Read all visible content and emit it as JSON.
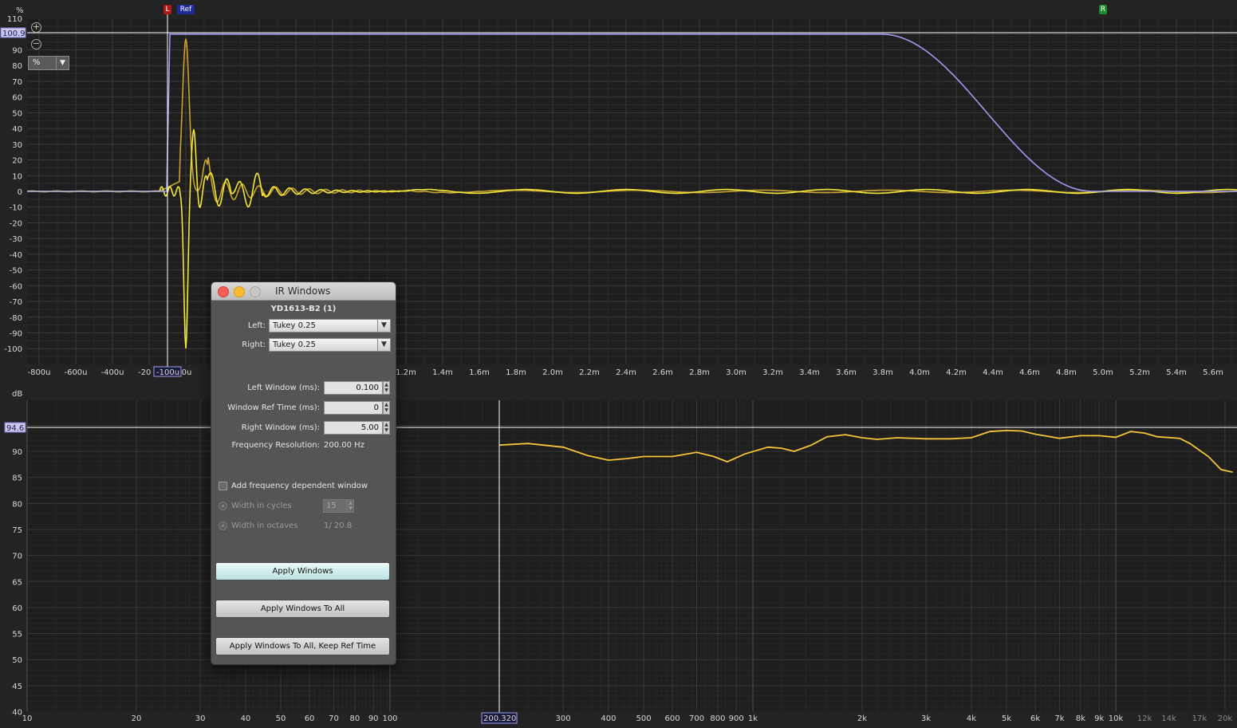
{
  "ir_plot": {
    "y_unit": "%",
    "unit_select": "%",
    "cursor_y": "100.9",
    "y_ticks": [
      "110",
      "100",
      "90",
      "80",
      "70",
      "60",
      "50",
      "40",
      "30",
      "20",
      "10",
      "0",
      "-10",
      "-20",
      "-30",
      "-40",
      "-50",
      "-60",
      "-70",
      "-80",
      "-90",
      "-100"
    ],
    "x_ticks": [
      "-800u",
      "-600u",
      "-400u",
      "-20",
      "0u",
      "1.2m",
      "1.4m",
      "1.6m",
      "1.8m",
      "2.0m",
      "2.2m",
      "2.4m",
      "2.6m",
      "2.8m",
      "3.0m",
      "3.2m",
      "3.4m",
      "3.6m",
      "3.8m",
      "4.0m",
      "4.2m",
      "4.4m",
      "4.6m",
      "4.8m",
      "5.0m",
      "5.2m",
      "5.4m",
      "5.6m"
    ],
    "cursor_x": "-100u",
    "markers": {
      "left": "L",
      "ref": "Ref",
      "right": "R"
    },
    "colors": {
      "window": "#9c9cf0",
      "ir_bright": "#f3e838",
      "ir_dark": "#c9a230",
      "background": "#1e1e1e"
    }
  },
  "fr_plot": {
    "y_unit": "dB",
    "cursor_y": "94.6",
    "y_ticks": [
      "90",
      "85",
      "80",
      "75",
      "70",
      "65",
      "60",
      "55",
      "50",
      "45",
      "40"
    ],
    "x_ticks": [
      "10",
      "20",
      "30",
      "40",
      "50",
      "60",
      "70",
      "80",
      "90",
      "100",
      "300",
      "400",
      "500",
      "600",
      "700",
      "800",
      "900",
      "1k",
      "2k",
      "3k",
      "4k",
      "5k",
      "6k",
      "7k",
      "8k",
      "9k",
      "10k",
      "12k",
      "14k",
      "17k",
      "20k"
    ],
    "cursor_x": "200.320",
    "colors": {
      "curve": "#f5c43a"
    }
  },
  "dialog": {
    "title": "IR Windows",
    "measurement": "YD1613-B2 (1)",
    "left_label": "Left:",
    "left_value": "Tukey 0.25",
    "right_label": "Right:",
    "right_value": "Tukey 0.25",
    "left_window_label": "Left Window (ms):",
    "left_window_value": "0.100",
    "ref_time_label": "Window Ref Time (ms):",
    "ref_time_value": "0",
    "right_window_label": "Right Window (ms):",
    "right_window_value": "5.00",
    "freq_res_label": "Frequency Resolution:",
    "freq_res_value": "200.00 Hz",
    "fdw_label": "Add frequency dependent window",
    "cycles_label": "Width in cycles",
    "cycles_value": "15",
    "octaves_label": "Width in octaves",
    "octaves_value": "1/ 20.8",
    "apply_label": "Apply Windows",
    "apply_all_label": "Apply Windows To All",
    "apply_all_keep_label": "Apply Windows To All, Keep Ref Time"
  }
}
